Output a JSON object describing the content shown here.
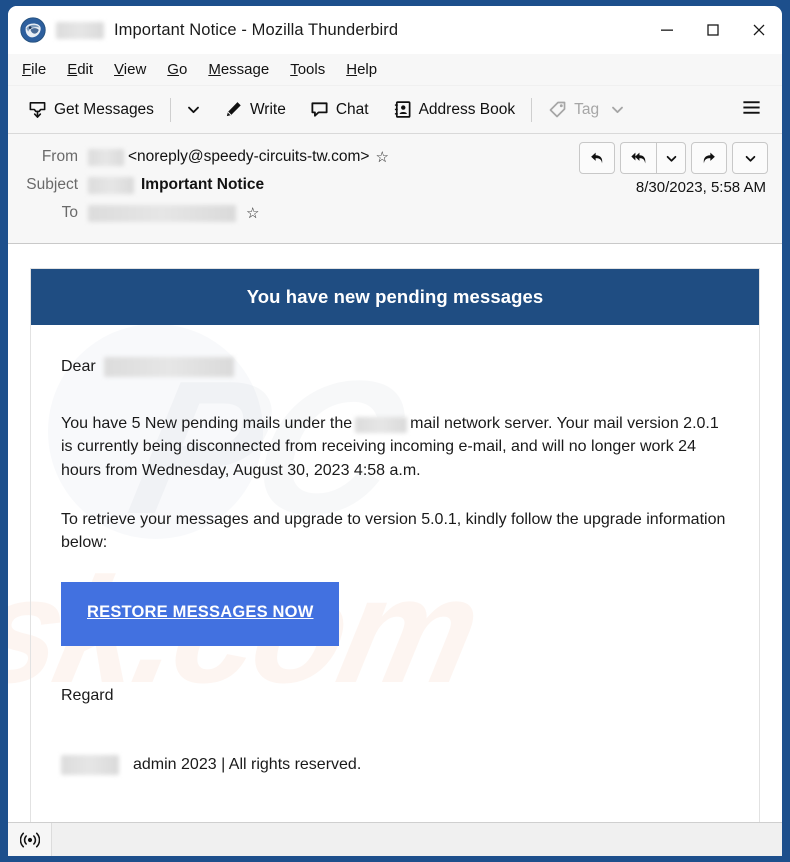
{
  "window": {
    "title": "Important Notice - Mozilla Thunderbird",
    "logo_icon": "thunderbird-logo-icon",
    "title_redacted": true,
    "controls": {
      "minimize": "minimize-icon",
      "maximize": "maximize-icon",
      "close": "close-icon"
    }
  },
  "menubar": {
    "items": [
      {
        "accesskey": "F",
        "rest": "ile"
      },
      {
        "accesskey": "E",
        "rest": "dit"
      },
      {
        "accesskey": "V",
        "rest": "iew"
      },
      {
        "accesskey": "G",
        "rest": "o"
      },
      {
        "accesskey": "M",
        "rest": "essage"
      },
      {
        "accesskey": "T",
        "rest": "ools"
      },
      {
        "accesskey": "H",
        "rest": "elp"
      }
    ]
  },
  "toolbar": {
    "get_messages_label": "Get Messages",
    "get_messages_icon": "inbox-download-icon",
    "get_messages_caret": "chevron-down-icon",
    "write_label": "Write",
    "write_icon": "pencil-icon",
    "chat_label": "Chat",
    "chat_icon": "speech-bubble-icon",
    "address_book_label": "Address Book",
    "address_book_icon": "address-book-icon",
    "tag_label": "Tag",
    "tag_icon": "tag-icon",
    "tag_caret": "chevron-down-icon",
    "tag_disabled": true,
    "app_menu_icon": "hamburger-menu-icon"
  },
  "message_header": {
    "from_label": "From",
    "from_redacted": true,
    "from_address": "<noreply@speedy-circuits-tw.com>",
    "from_star_icon": "star-icon",
    "subject_label": "Subject",
    "subject_redacted": true,
    "subject_value": "Important Notice",
    "to_label": "To",
    "to_redacted": true,
    "to_star_icon": "star-icon",
    "date": "8/30/2023, 5:58 AM",
    "actions": [
      {
        "name": "reply-button",
        "icon": "reply-arrow-icon"
      },
      {
        "name": "reply-all-button",
        "icon": "reply-all-arrow-icon"
      },
      {
        "name": "reply-all-dropdown",
        "icon": "chevron-down-icon"
      },
      {
        "name": "forward-button",
        "icon": "forward-arrow-icon"
      },
      {
        "name": "more-actions-dropdown",
        "icon": "chevron-down-icon"
      }
    ]
  },
  "email": {
    "banner_title": "You have new pending messages",
    "banner_color": "#1f4d82",
    "greeting": "Dear",
    "greeting_redacted": true,
    "paragraph1_part1": "You have 5 New pending mails under the",
    "paragraph1_redacted": true,
    "paragraph1_part2": "mail network server. Your mail version 2.0.1 is currently being disconnected from receiving incoming e-mail, and will no longer work 24 hours from Wednesday, August 30, 2023 4:58 a.m.",
    "paragraph2": "To retrieve your messages and upgrade to version 5.0.1, kindly follow the upgrade information below:",
    "cta_label": "RESTORE MESSAGES NOW",
    "cta_color": "#4271e0",
    "signoff": "Regard",
    "footer_redacted": true,
    "footer_text": "admin 2023 | All rights reserved.",
    "watermark_primary": "sk.com",
    "watermark_secondary": "PC"
  },
  "statusbar": {
    "connection_icon": "broadcast-online-icon"
  }
}
